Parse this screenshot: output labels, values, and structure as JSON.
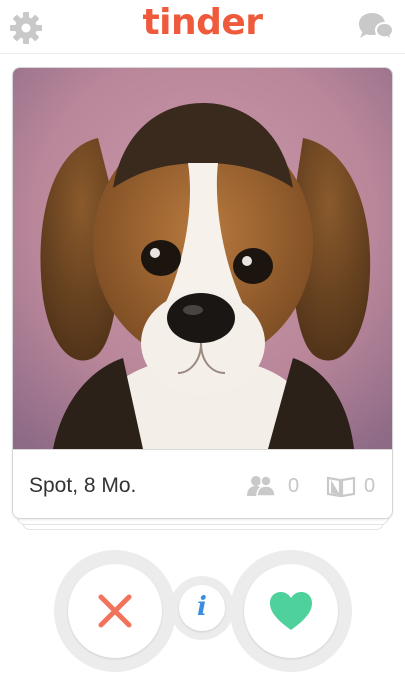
{
  "header": {
    "logo_text": "tinder",
    "icons": {
      "settings": "gear-icon",
      "messages": "chat-bubbles-icon"
    },
    "brand_color": "#ef5a3c",
    "icon_color": "#c9c9c9"
  },
  "card": {
    "name_age": "Spot, 8 Mo.",
    "shared_friends": "0",
    "shared_interests": "0",
    "photo": "beagle-puppy-photo"
  },
  "actions": {
    "nope_icon": "x-icon",
    "info_label": "i",
    "like_icon": "heart-icon",
    "nope_color": "#f2735b",
    "like_color": "#4fd19b",
    "info_color": "#3c8de0"
  }
}
